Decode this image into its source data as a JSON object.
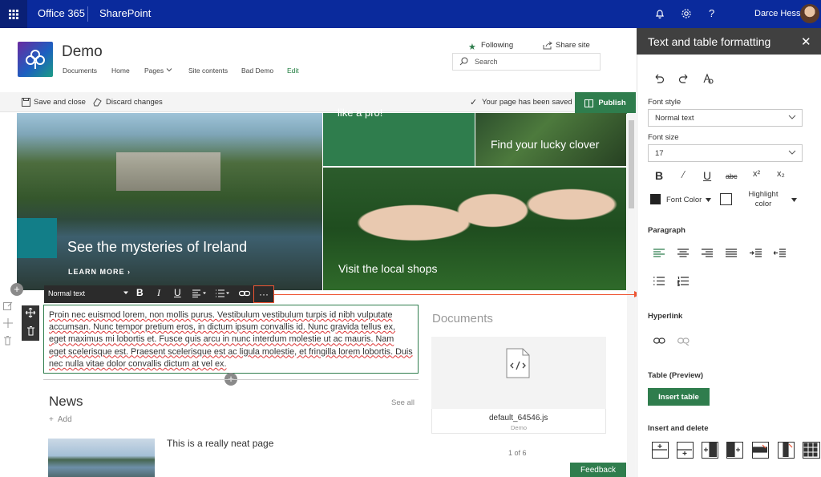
{
  "suite": {
    "app": "Office 365",
    "product": "SharePoint",
    "user": "Darce Hess"
  },
  "site": {
    "title": "Demo",
    "nav": [
      "Documents",
      "Home",
      "Pages",
      "Site contents",
      "Bad Demo",
      "Edit"
    ],
    "following": "Following",
    "share": "Share site",
    "search_placeholder": "Search"
  },
  "commandbar": {
    "save_close": "Save and close",
    "discard": "Discard changes",
    "status": "Your page has been saved",
    "publish": "Publish"
  },
  "hero": {
    "main_title": "See the mysteries of Ireland",
    "learn_more": "LEARN MORE",
    "tile_pro": "like a pro!",
    "tile_clover": "Find your lucky clover",
    "tile_pigs": "Visit the local shops"
  },
  "toolbar": {
    "style": "Normal text",
    "more": "···"
  },
  "text_part": {
    "body": "Proin nec euismod lorem, non mollis purus. Vestibulum vestibulum turpis id nibh vulputate accumsan. Nunc tempor pretium eros, in dictum ipsum convallis id. Nunc gravida tellus ex, eget maximus mi lobortis et. Fusce quis arcu in nunc interdum molestie ut ac mauris. Nam eget scelerisque est. Praesent scelerisque est ac ligula molestie, et fringilla lorem lobortis. Duis nec nulla vitae dolor convallis dictum at vel ex."
  },
  "news": {
    "title": "News",
    "see_all": "See all",
    "add": "Add",
    "item_title": "This is a really neat page"
  },
  "documents": {
    "title": "Documents",
    "file_name": "default_64546.js",
    "file_sub": "Demo",
    "pager": "1 of 6",
    "feedback": "Feedback"
  },
  "pane": {
    "title": "Text and table formatting",
    "font_style_label": "Font style",
    "font_style_value": "Normal text",
    "font_size_label": "Font size",
    "font_size_value": "17",
    "font_color": "Font Color",
    "highlight_color": "Highlight color",
    "paragraph": "Paragraph",
    "hyperlink": "Hyperlink",
    "table_preview": "Table (Preview)",
    "insert_table": "Insert table",
    "insert_delete": "Insert and delete"
  },
  "colors": {
    "suite_bar": "#0a2a9c",
    "accent_green": "#2f7d4d",
    "pane_header": "#404040",
    "callout_red": "#e53e2e"
  }
}
